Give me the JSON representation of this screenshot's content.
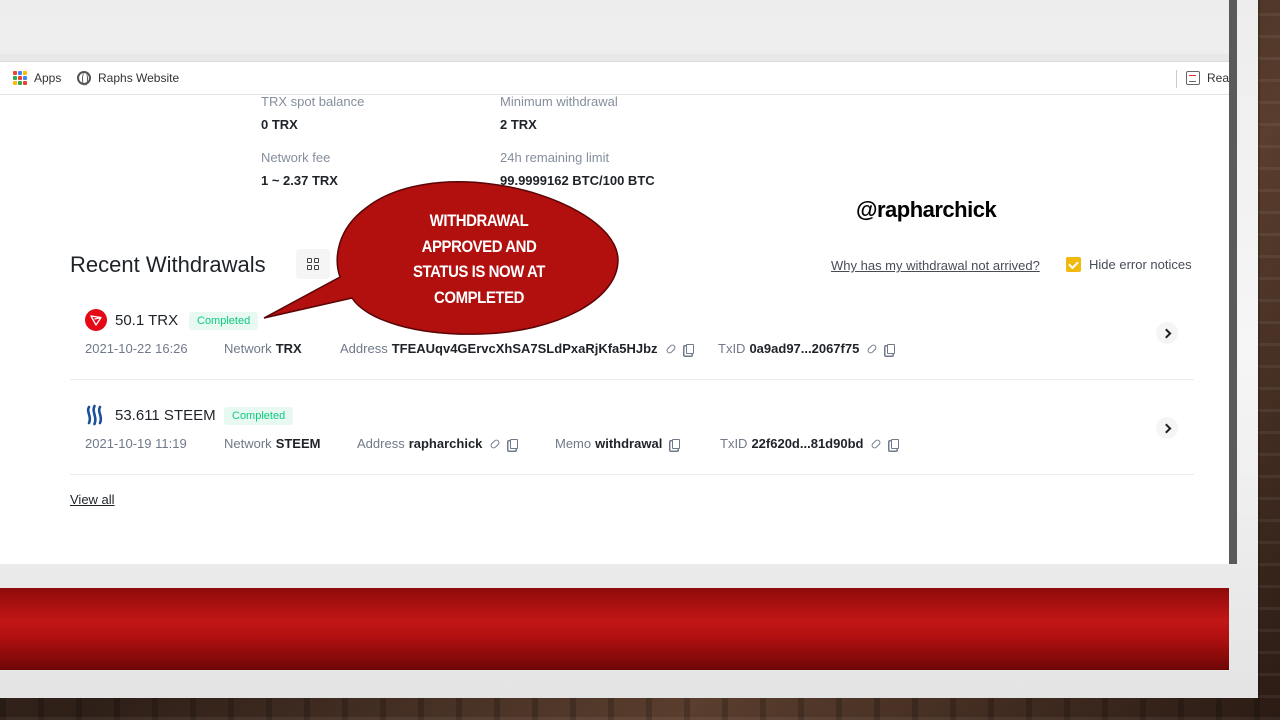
{
  "bookmarks": {
    "apps_label": "Apps",
    "site_label": "Raphs Website",
    "reading_label": "Readi"
  },
  "summary": {
    "spot_balance_label": "TRX spot balance",
    "spot_balance_value": "0 TRX",
    "min_withdrawal_label": "Minimum withdrawal",
    "min_withdrawal_value": "2 TRX",
    "network_fee_label": "Network fee",
    "network_fee_value": "1 ~ 2.37 TRX",
    "remaining_limit_label": "24h remaining limit",
    "remaining_limit_value": "99.9999162 BTC/100 BTC"
  },
  "watermark": "@rapharchick",
  "recent": {
    "title": "Recent Withdrawals",
    "why_link": "Why has my withdrawal not arrived?",
    "hide_errors_label": "Hide error notices",
    "hide_errors_checked": true,
    "view_all": "View all"
  },
  "withdrawals": [
    {
      "amount": "50.1 TRX",
      "status": "Completed",
      "datetime": "2021-10-22 16:26",
      "network_label": "Network",
      "network": "TRX",
      "address_label": "Address",
      "address": "TFEAUqv4GErvcXhSA7SLdPxaRjKfa5HJbz",
      "txid_label": "TxID",
      "txid": "0a9ad97...2067f75",
      "icon": "tron-icon"
    },
    {
      "amount": "53.611 STEEM",
      "status": "Completed",
      "datetime": "2021-10-19 11:19",
      "network_label": "Network",
      "network": "STEEM",
      "address_label": "Address",
      "address": "rapharchick",
      "memo_label": "Memo",
      "memo": "withdrawal",
      "txid_label": "TxID",
      "txid": "22f620d...81d90bd",
      "icon": "steem-icon"
    }
  ],
  "callout": {
    "text": "WITHDRAWAL APPROVED AND STATUS IS NOW AT COMPLETED"
  },
  "colors": {
    "accent_yellow": "#f0b90b",
    "status_green": "#0ecb81",
    "callout_red": "#b20f0f",
    "band_red": "#c21616",
    "tron_red": "#e50915"
  }
}
